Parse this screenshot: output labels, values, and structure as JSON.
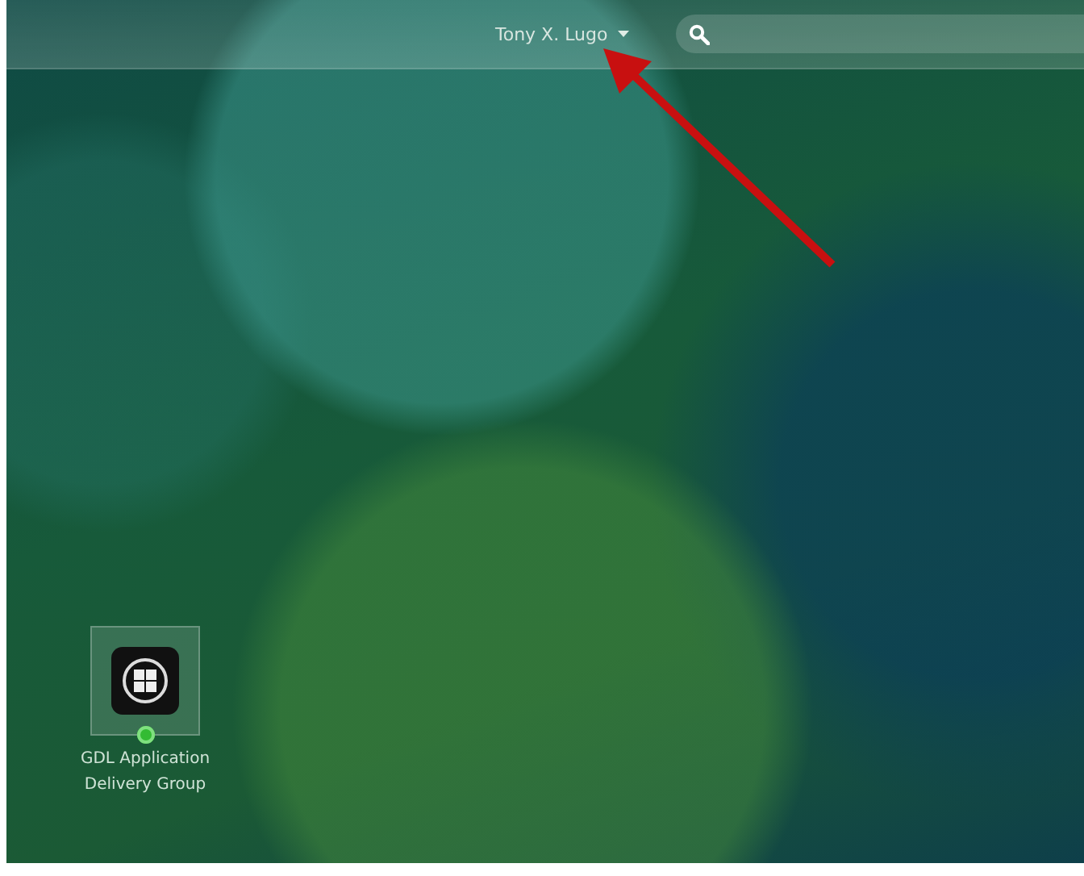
{
  "top_bar": {
    "user_name": "Tony X. Lugo"
  },
  "apps": [
    {
      "label": "GDL Application Delivery Group",
      "online": true
    }
  ]
}
